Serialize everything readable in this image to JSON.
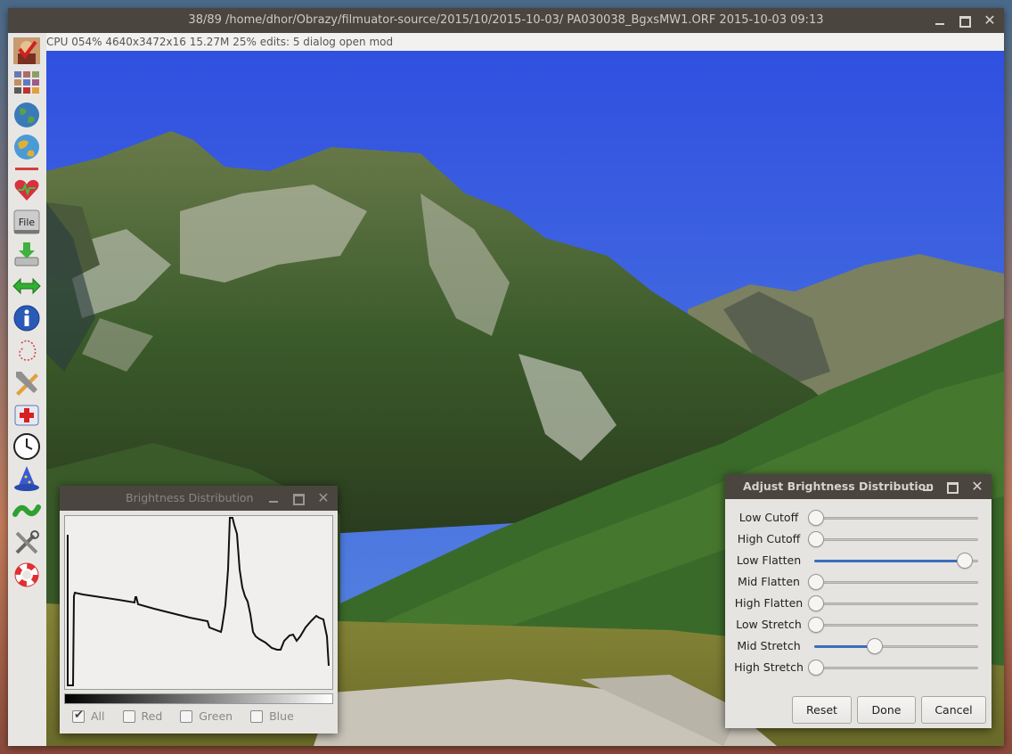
{
  "window": {
    "title": "38/89  /home/dhor/Obrazy/filmuator-source/2015/10/2015-10-03/  PA030038_BgxsMW1.ORF  2015-10-03 09:13"
  },
  "status_line": "CPU 054%  4640x3472x16  15.27M  25%  edits: 5  dialog open  mod",
  "sidebar": {
    "tools": [
      {
        "icon": "photo-edit-icon"
      },
      {
        "icon": "thumbnail-gallery-icon"
      },
      {
        "icon": "globe-icon"
      },
      {
        "icon": "globe-color-icon"
      },
      {
        "icon": "favorite-heart-icon"
      },
      {
        "icon": "file-menu-icon",
        "label": "File"
      },
      {
        "icon": "save-download-icon"
      },
      {
        "icon": "resize-arrows-icon"
      },
      {
        "icon": "info-icon"
      },
      {
        "icon": "selection-lasso-icon"
      },
      {
        "icon": "edit-tools-icon"
      },
      {
        "icon": "first-aid-icon"
      },
      {
        "icon": "clock-icon"
      },
      {
        "icon": "wizard-hat-icon"
      },
      {
        "icon": "green-snake-icon"
      },
      {
        "icon": "settings-tools-icon"
      },
      {
        "icon": "help-lifebuoy-icon"
      }
    ]
  },
  "histogram_dialog": {
    "title": "Brightness Distribution",
    "checks": [
      {
        "label": "All",
        "checked": true
      },
      {
        "label": "Red",
        "checked": false
      },
      {
        "label": "Green",
        "checked": false
      },
      {
        "label": "Blue",
        "checked": false
      }
    ]
  },
  "adjust_dialog": {
    "title": "Adjust Brightness Distribution",
    "sliders": [
      {
        "label": "Low Cutoff",
        "value": 0.0
      },
      {
        "label": "High Cutoff",
        "value": 0.0
      },
      {
        "label": "Low Flatten",
        "value": 0.91
      },
      {
        "label": "Mid Flatten",
        "value": 0.0
      },
      {
        "label": "High Flatten",
        "value": 0.0
      },
      {
        "label": "Low Stretch",
        "value": 0.0
      },
      {
        "label": "Mid Stretch",
        "value": 0.36
      },
      {
        "label": "High Stretch",
        "value": 0.0
      }
    ],
    "buttons": {
      "reset": "Reset",
      "done": "Done",
      "cancel": "Cancel"
    }
  },
  "colors": {
    "accent": "#3a6dbd",
    "titlebar": "#4a453f",
    "sky": "#3a5ad8"
  }
}
